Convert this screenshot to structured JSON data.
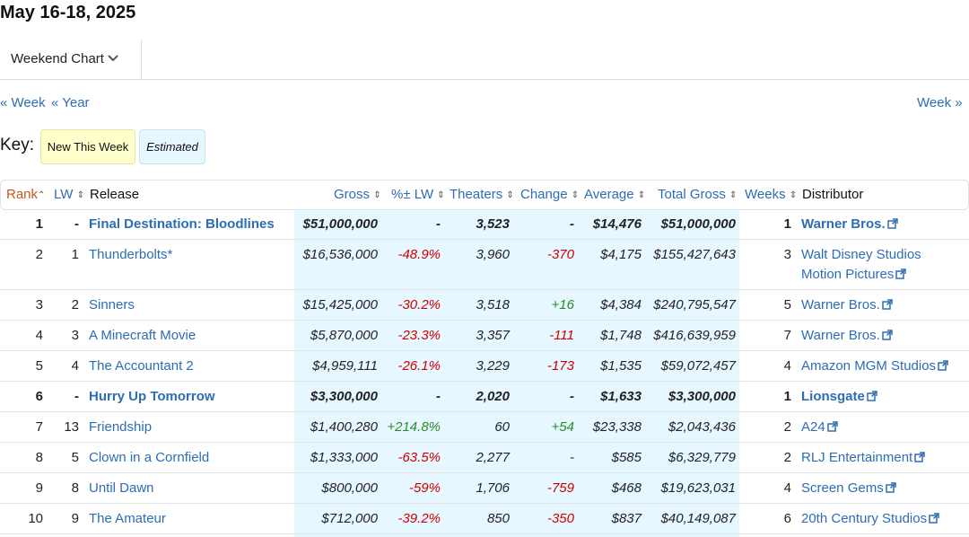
{
  "header": {
    "date_range": "May 16-18, 2025",
    "chart_selector": "Weekend Chart"
  },
  "nav": {
    "prev_week": "« Week",
    "prev_year": "« Year",
    "next_week": "Week »"
  },
  "key": {
    "label": "Key:",
    "new_this_week": "New This Week",
    "estimated": "Estimated"
  },
  "columns": {
    "rank": "Rank",
    "lw": "LW",
    "release": "Release",
    "gross": "Gross",
    "pct_lw": "%± LW",
    "theaters": "Theaters",
    "change": "Change",
    "average": "Average",
    "total_gross": "Total Gross",
    "weeks": "Weeks",
    "distributor": "Distributor"
  },
  "rows": [
    {
      "rank": "1",
      "lw": "-",
      "release": "Final Destination: Bloodlines",
      "gross": "$51,000,000",
      "pct_lw": "-",
      "theaters": "3,523",
      "change": "-",
      "average": "$14,476",
      "total_gross": "$51,000,000",
      "weeks": "1",
      "distributor": "Warner Bros.",
      "distributor_line2": ""
    },
    {
      "rank": "2",
      "lw": "1",
      "release": "Thunderbolts*",
      "gross": "$16,536,000",
      "pct_lw": "-48.9%",
      "theaters": "3,960",
      "change": "-370",
      "average": "$4,175",
      "total_gross": "$155,427,643",
      "weeks": "3",
      "distributor": "Walt Disney Studios",
      "distributor_line2": "Motion Pictures"
    },
    {
      "rank": "3",
      "lw": "2",
      "release": "Sinners",
      "gross": "$15,425,000",
      "pct_lw": "-30.2%",
      "theaters": "3,518",
      "change": "+16",
      "average": "$4,384",
      "total_gross": "$240,795,547",
      "weeks": "5",
      "distributor": "Warner Bros.",
      "distributor_line2": ""
    },
    {
      "rank": "4",
      "lw": "3",
      "release": "A Minecraft Movie",
      "gross": "$5,870,000",
      "pct_lw": "-23.3%",
      "theaters": "3,357",
      "change": "-111",
      "average": "$1,748",
      "total_gross": "$416,639,959",
      "weeks": "7",
      "distributor": "Warner Bros.",
      "distributor_line2": ""
    },
    {
      "rank": "5",
      "lw": "4",
      "release": "The Accountant 2",
      "gross": "$4,959,111",
      "pct_lw": "-26.1%",
      "theaters": "3,229",
      "change": "-173",
      "average": "$1,535",
      "total_gross": "$59,072,457",
      "weeks": "4",
      "distributor": "Amazon MGM Studios",
      "distributor_line2": ""
    },
    {
      "rank": "6",
      "lw": "-",
      "release": "Hurry Up Tomorrow",
      "gross": "$3,300,000",
      "pct_lw": "-",
      "theaters": "2,020",
      "change": "-",
      "average": "$1,633",
      "total_gross": "$3,300,000",
      "weeks": "1",
      "distributor": "Lionsgate",
      "distributor_line2": ""
    },
    {
      "rank": "7",
      "lw": "13",
      "release": "Friendship",
      "gross": "$1,400,280",
      "pct_lw": "+214.8%",
      "theaters": "60",
      "change": "+54",
      "average": "$23,338",
      "total_gross": "$2,043,436",
      "weeks": "2",
      "distributor": "A24",
      "distributor_line2": ""
    },
    {
      "rank": "8",
      "lw": "5",
      "release": "Clown in a Cornfield",
      "gross": "$1,333,000",
      "pct_lw": "-63.5%",
      "theaters": "2,277",
      "change": "-",
      "average": "$585",
      "total_gross": "$6,329,779",
      "weeks": "2",
      "distributor": "RLJ Entertainment",
      "distributor_line2": ""
    },
    {
      "rank": "9",
      "lw": "8",
      "release": "Until Dawn",
      "gross": "$800,000",
      "pct_lw": "-59%",
      "theaters": "1,706",
      "change": "-759",
      "average": "$468",
      "total_gross": "$19,623,031",
      "weeks": "4",
      "distributor": "Screen Gems",
      "distributor_line2": ""
    },
    {
      "rank": "10",
      "lw": "9",
      "release": "The Amateur",
      "gross": "$712,000",
      "pct_lw": "-39.2%",
      "theaters": "850",
      "change": "-350",
      "average": "$837",
      "total_gross": "$40,149,087",
      "weeks": "6",
      "distributor": "20th Century Studios",
      "distributor_line2": ""
    }
  ],
  "colors": {
    "link": "#2d6db5",
    "negative": "#cc0000",
    "positive": "#2a8a2a",
    "new_this_week": "#ffffcc",
    "estimated": "#e6f7ff"
  }
}
